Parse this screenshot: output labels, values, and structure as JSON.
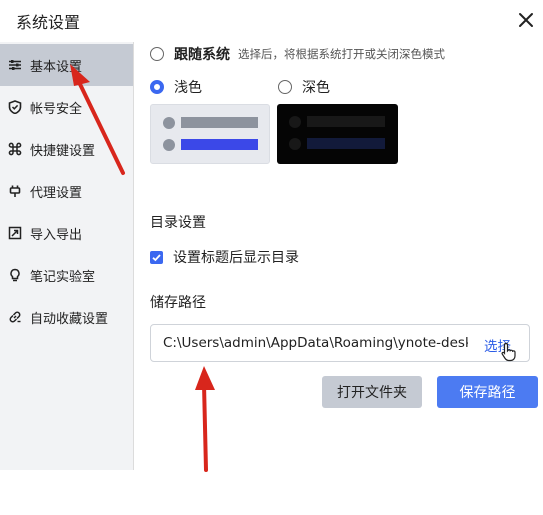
{
  "window": {
    "title": "系统设置"
  },
  "sidebar": {
    "items": [
      {
        "label": "基本设置",
        "icon": "sliders-icon",
        "active": true
      },
      {
        "label": "帐号安全",
        "icon": "shield-icon"
      },
      {
        "label": "快捷键设置",
        "icon": "command-key-icon"
      },
      {
        "label": "代理设置",
        "icon": "plug-icon"
      },
      {
        "label": "导入导出",
        "icon": "import-export-icon"
      },
      {
        "label": "笔记实验室",
        "icon": "lightbulb-icon"
      },
      {
        "label": "自动收藏设置",
        "icon": "link-icon"
      }
    ]
  },
  "appearance": {
    "follow_system": {
      "label": "跟随系统",
      "hint": "选择后，将根据系统打开或关闭深色模式",
      "selected": false
    },
    "light": {
      "label": "浅色",
      "selected": true
    },
    "dark": {
      "label": "深色",
      "selected": false
    }
  },
  "toc": {
    "title": "目录设置",
    "checkbox_label": "设置标题后显示目录",
    "checked": true
  },
  "storage": {
    "title": "储存路径",
    "path": "C:\\Users\\admin\\AppData\\Roaming\\ynote-desktop",
    "choose_label": "选择",
    "open_folder_label": "打开文件夹",
    "save_path_label": "保存路径"
  },
  "colors": {
    "accent": "#3b68f0",
    "sidebar_bg": "#f2f3f5",
    "sidebar_active": "#c5cad3",
    "save_button": "#4c7bf2",
    "annotation_arrow": "#d8261c"
  }
}
